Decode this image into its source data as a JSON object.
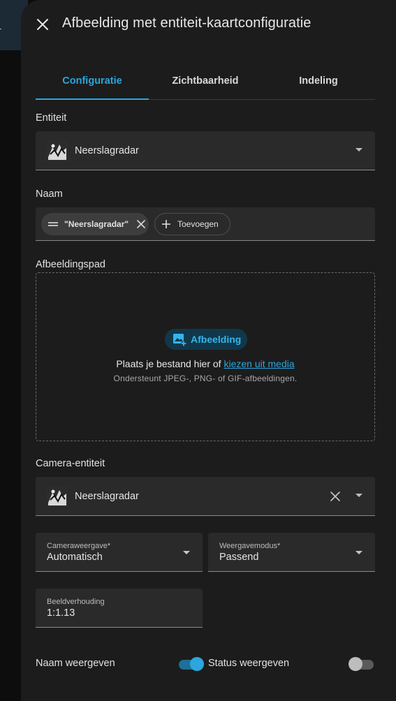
{
  "dialog": {
    "title": "Afbeelding met entiteit-kaartconfiguratie"
  },
  "tabs": [
    {
      "label": "Configuratie",
      "active": true
    },
    {
      "label": "Zichtbaarheid",
      "active": false
    },
    {
      "label": "Indeling",
      "active": false
    }
  ],
  "entity": {
    "label": "Entiteit",
    "value": "Neerslagradar"
  },
  "name": {
    "label": "Naam",
    "chip_value": "\"Neerslagradar\"",
    "add_label": "Toevoegen"
  },
  "image_path": {
    "label": "Afbeeldingspad",
    "upload_button": "Afbeelding",
    "drop_text": "Plaats je bestand hier of",
    "drop_link": "kiezen uit media",
    "hint": "Ondersteunt JPEG-, PNG- of GIF-afbeeldingen."
  },
  "camera_entity": {
    "label": "Camera-entiteit",
    "value": "Neerslagradar"
  },
  "camera_view": {
    "label": "Cameraweergave*",
    "value": "Automatisch"
  },
  "display_mode": {
    "label": "Weergavemodus*",
    "value": "Passend"
  },
  "aspect_ratio": {
    "label": "Beeldverhouding",
    "value": "1:1.13"
  },
  "toggles": {
    "show_name": {
      "label": "Naam weergeven",
      "on": true
    },
    "show_state": {
      "label": "Status weergeven",
      "on": false
    }
  },
  "colors": {
    "accent": "#2ba6de",
    "surface": "#1c1c1c",
    "field": "#2a2a2a"
  }
}
